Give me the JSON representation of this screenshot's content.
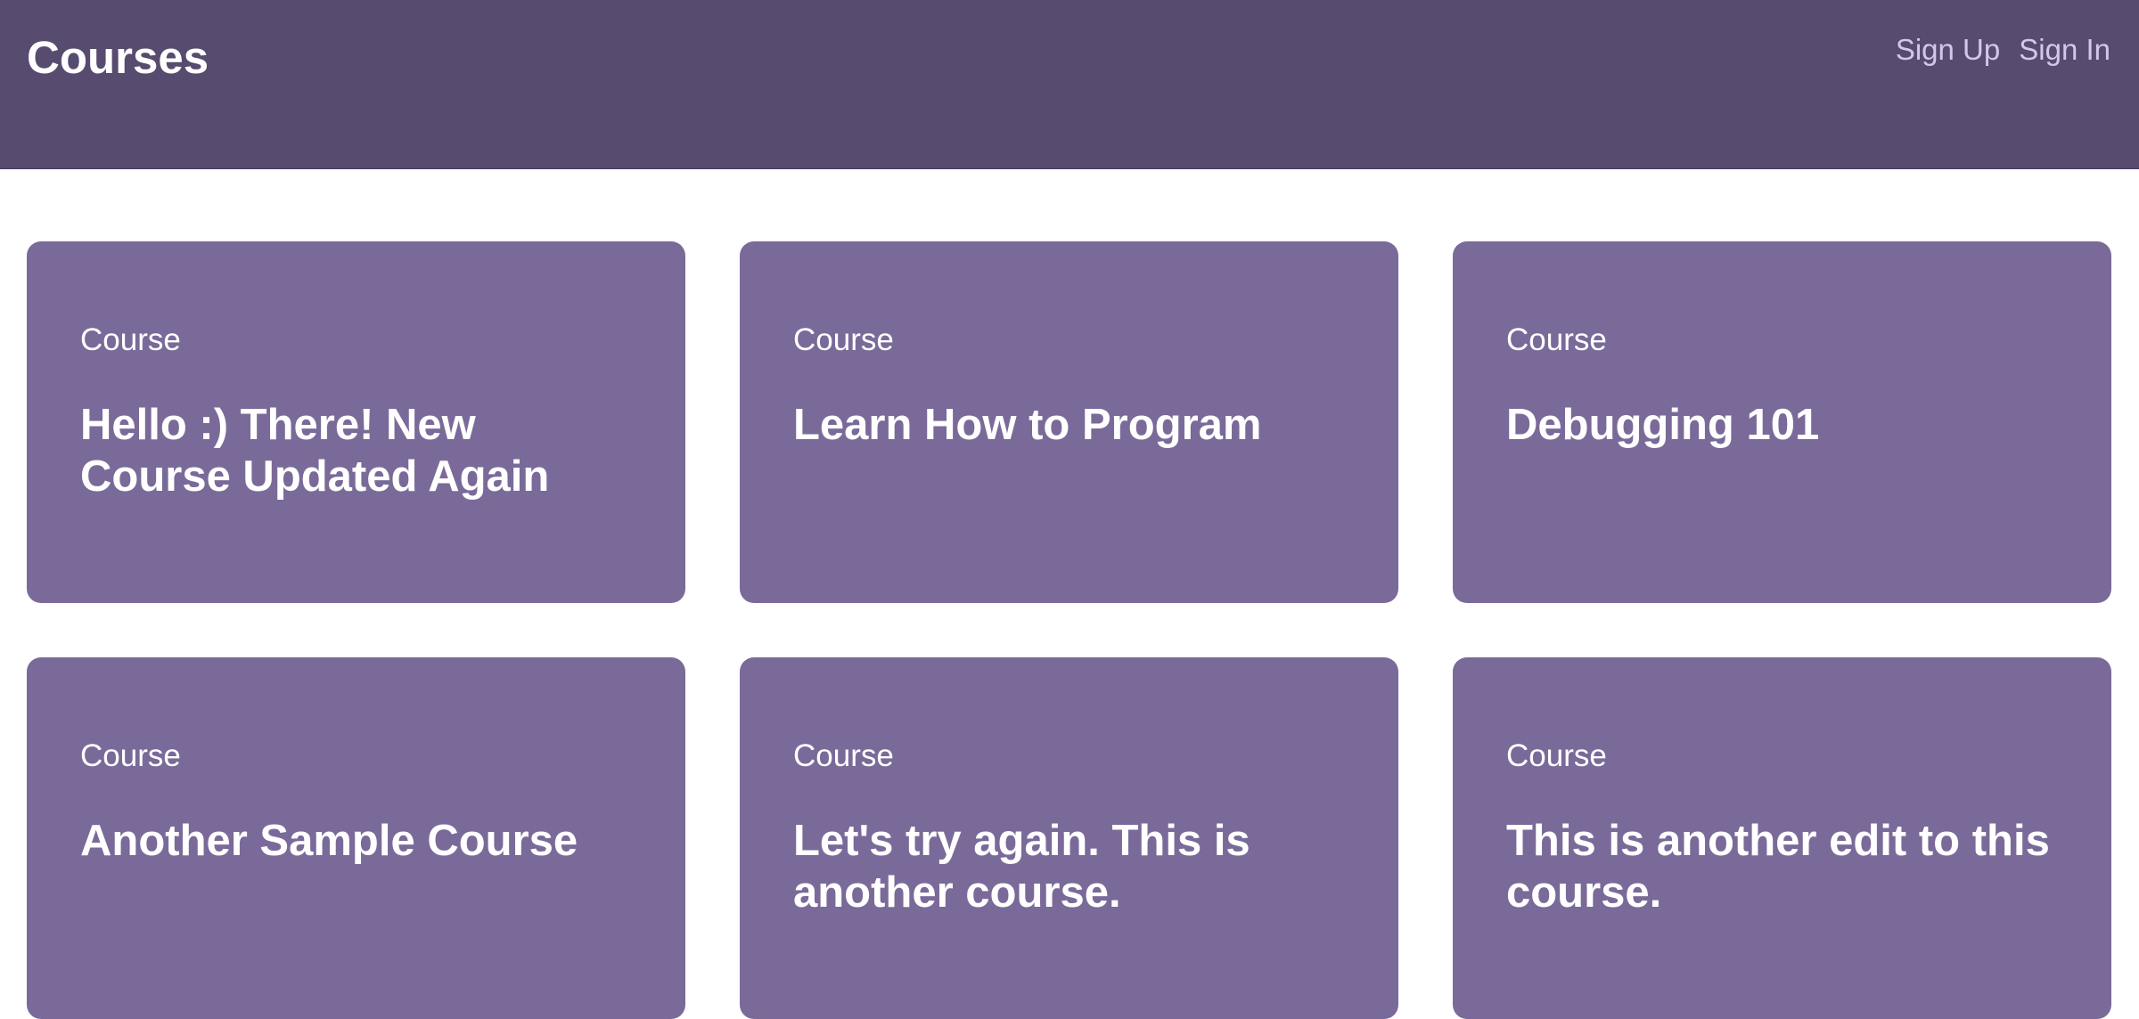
{
  "header": {
    "title": "Courses",
    "nav": {
      "sign_up": "Sign Up",
      "sign_in": "Sign In"
    }
  },
  "courses": [
    {
      "label": "Course",
      "title": "Hello :) There! New Course Updated Again"
    },
    {
      "label": "Course",
      "title": "Learn How to Program"
    },
    {
      "label": "Course",
      "title": "Debugging 101"
    },
    {
      "label": "Course",
      "title": "Another Sample Course"
    },
    {
      "label": "Course",
      "title": "Let's try again. This is another course."
    },
    {
      "label": "Course",
      "title": "This is another edit to this course."
    }
  ],
  "colors": {
    "header_bg": "#574b6f",
    "card_bg": "#7a6a99",
    "nav_link": "#d6c7e8"
  }
}
